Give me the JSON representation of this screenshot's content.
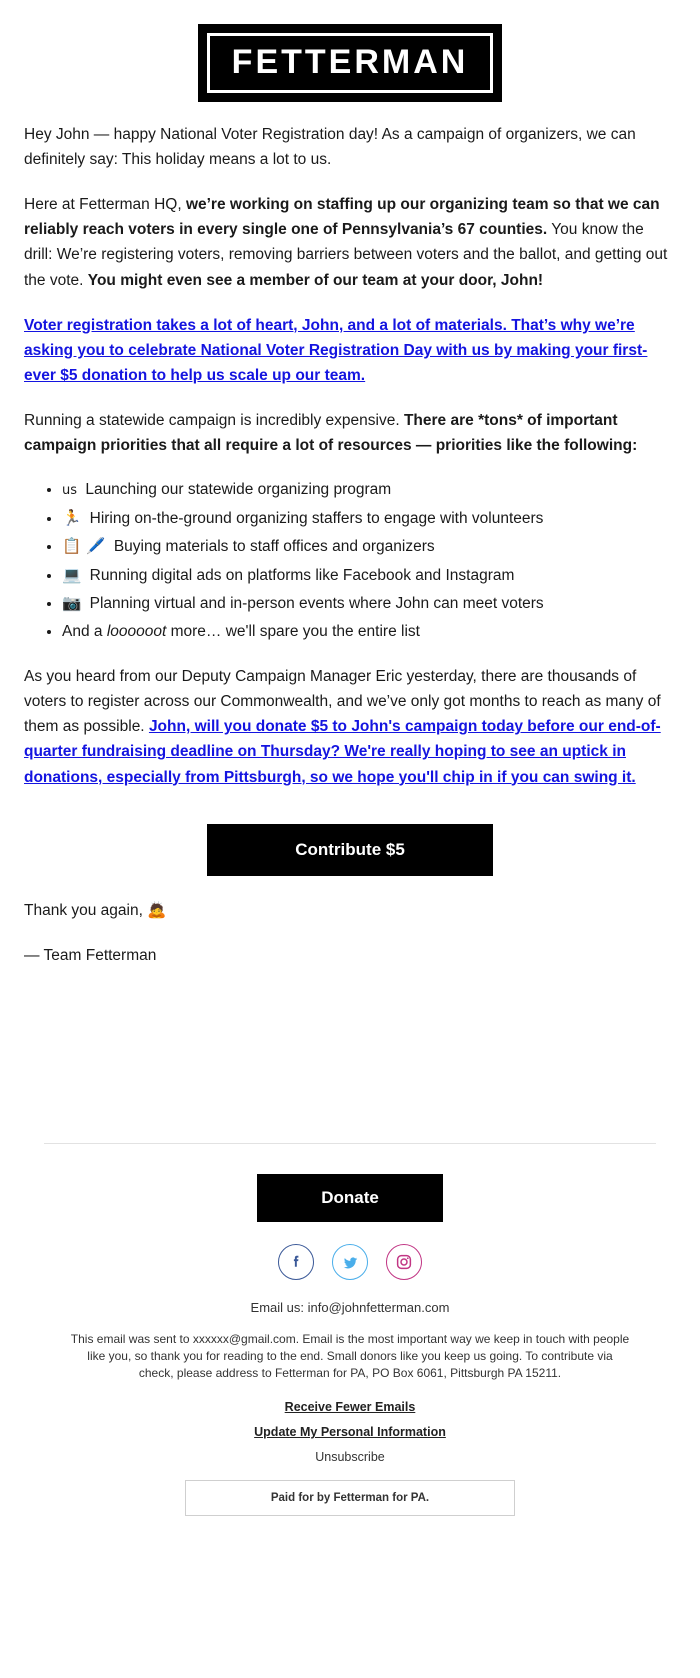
{
  "logo": {
    "text": "FETTERMAN"
  },
  "body": {
    "p1": "Hey John — happy National Voter Registration day! As a campaign of organizers, we can definitely say: This holiday means a lot to us.",
    "p2_lead": "Here at Fetterman HQ, ",
    "p2_bold1": "we’re working on staffing up our organizing team so that we can reliably reach voters in every single one of Pennsylvania’s 67 counties.",
    "p2_mid": " You know the drill: We’re registering voters, removing barriers between voters and the ballot, and getting out the vote. ",
    "p2_bold2": "You might even see a member of our team at your door, John!",
    "link_para_1": "Voter registration takes a lot of heart, John, and a lot of materials. That’s why we’re asking you to celebrate National Voter Registration Day with us by making your first-ever $5 donation to help us scale up our team.",
    "p3_lead": "Running a statewide campaign is incredibly expensive. ",
    "p3_bold": "There are *tons* of important campaign priorities that all require a lot of resources — priorities like the following:",
    "p4_lead": "As you heard from our Deputy Campaign Manager Eric yesterday, there are thousands of voters to register across our Commonwealth, and we’ve only got months to reach as many of them as possible. ",
    "link_para_2": "John, will you donate $5 to John's campaign today before our end-of-quarter fundraising deadline on Thursday? We're really hoping to see an uptick in donations, especially from Pittsburgh, so we hope you'll chip in if you can swing it.",
    "signoff_1": "Thank you again, ",
    "signoff_emoji": "🙇",
    "signoff_2": "— Team Fetterman"
  },
  "priorities": [
    {
      "emoji": "us",
      "emoji_name": "us-flag-icon",
      "text": " Launching our statewide organizing program",
      "small": true
    },
    {
      "emoji": "🏃",
      "emoji_name": "runner-icon",
      "text": " Hiring on-the-ground organizing staffers to engage with volunteers",
      "small": false
    },
    {
      "emoji": "📋 🖊️",
      "emoji_name": "clipboard-pen-icon",
      "text": " Buying materials to staff offices and organizers",
      "small": false
    },
    {
      "emoji": "💻",
      "emoji_name": "laptop-icon",
      "text": "  Running digital ads on platforms like Facebook and Instagram",
      "small": false
    },
    {
      "emoji": "📷",
      "emoji_name": "camera-icon",
      "text": "  Planning virtual and in-person events where John can meet voters",
      "small": false
    }
  ],
  "priority_last": {
    "pre": "And a ",
    "italic": "loooooot",
    "post": " more… we'll spare you the entire list"
  },
  "cta": {
    "label": "Contribute $5"
  },
  "footer": {
    "donate_label": "Donate",
    "social": [
      {
        "name": "facebook-icon",
        "label": "Facebook"
      },
      {
        "name": "twitter-icon",
        "label": "Twitter"
      },
      {
        "name": "instagram-icon",
        "label": "Instagram"
      }
    ],
    "email_us": "Email us: info@johnfetterman.com",
    "legal": "This email was sent to xxxxxx@gmail.com. Email is the most important way we keep in touch with people like you, so thank you for reading to the end. Small donors like you keep us going. To contribute via check, please address to Fetterman for PA, PO Box 6061, Pittsburgh PA 15211.",
    "link_fewer": "Receive Fewer Emails",
    "link_update": "Update My Personal Information",
    "link_unsub": "Unsubscribe",
    "paid_for": "Paid for by Fetterman for PA."
  },
  "colors": {
    "link": "#1414e0",
    "button": "#000000",
    "facebook": "#3b5998",
    "twitter": "#4aaeea",
    "instagram": "#c13584"
  }
}
